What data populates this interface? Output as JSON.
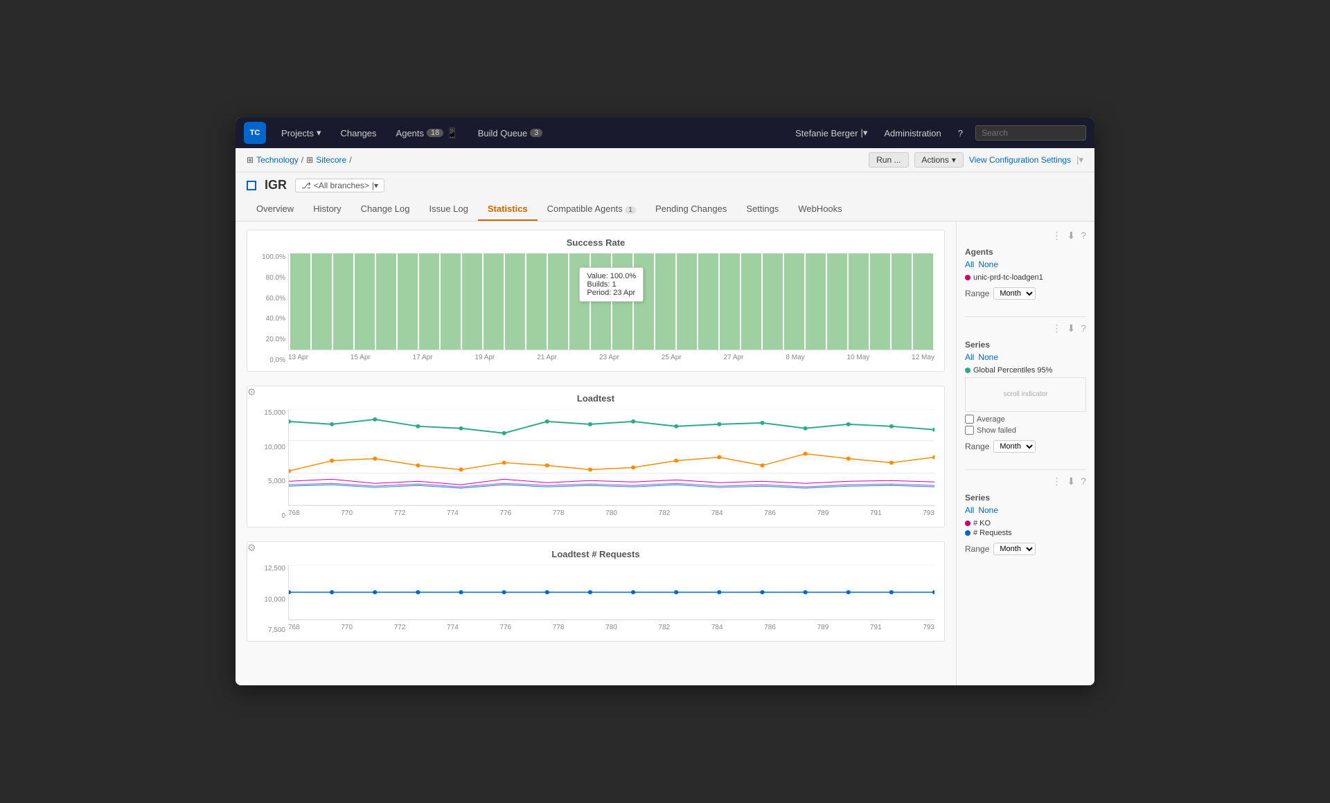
{
  "app": {
    "logo": "TC",
    "nav_items": [
      {
        "label": "Projects",
        "has_arrow": true
      },
      {
        "label": "Changes",
        "has_arrow": false
      },
      {
        "label": "Agents",
        "badge": "18",
        "has_icon": true
      },
      {
        "label": "Build Queue",
        "badge": "3"
      }
    ],
    "user": "Stefanie Berger",
    "admin": "Administration",
    "search_placeholder": "Search"
  },
  "breadcrumb": {
    "items": [
      "Technology",
      "Sitecore"
    ]
  },
  "toolbar": {
    "run_label": "Run ...",
    "actions_label": "Actions",
    "view_config_label": "View Configuration Settings"
  },
  "project": {
    "name": "IGR",
    "branch": "<All branches>"
  },
  "tabs": [
    {
      "label": "Overview",
      "active": false
    },
    {
      "label": "History",
      "active": false
    },
    {
      "label": "Change Log",
      "active": false
    },
    {
      "label": "Issue Log",
      "active": false
    },
    {
      "label": "Statistics",
      "active": true
    },
    {
      "label": "Compatible Agents",
      "badge": "1",
      "active": false
    },
    {
      "label": "Pending Changes",
      "active": false
    },
    {
      "label": "Settings",
      "active": false
    },
    {
      "label": "WebHooks",
      "active": false
    }
  ],
  "charts": {
    "success_rate": {
      "title": "Success Rate",
      "y_labels": [
        "100.0%",
        "80.0%",
        "60.0%",
        "40.0%",
        "20.0%",
        "0.0%"
      ],
      "x_labels": [
        "13 Apr",
        "15 Apr",
        "17 Apr",
        "19 Apr",
        "21 Apr",
        "23 Apr",
        "25 Apr",
        "27 Apr",
        "8 May",
        "10 May",
        "12 May"
      ],
      "tooltip": {
        "value": "Value: 100.0%",
        "builds": "Builds: 1",
        "period": "Period: 23 Apr"
      },
      "bar_count": 30,
      "agents": {
        "label": "Agents",
        "all": "All",
        "none": "None",
        "items": [
          {
            "name": "unic-prd-tc-loadgen1",
            "color": "#cc0066"
          }
        ]
      },
      "range_label": "Range",
      "range_value": "Month"
    },
    "loadtest": {
      "title": "Loadtest",
      "y_labels": [
        "15,000",
        "10,000",
        "5,000",
        "0"
      ],
      "x_labels": [
        "768",
        "770",
        "772",
        "774",
        "776",
        "778",
        "780",
        "782",
        "784",
        "786",
        "789",
        "791",
        "793"
      ],
      "series": {
        "label": "Series",
        "all": "All",
        "none": "None",
        "items": [
          {
            "name": "Global Percentiles 95%",
            "color": "#2daa88"
          }
        ]
      },
      "average_label": "Average",
      "show_failed_label": "Show failed",
      "range_label": "Range",
      "range_value": "Month"
    },
    "loadtest_requests": {
      "title": "Loadtest # Requests",
      "y_labels": [
        "12,500",
        "10,000",
        "7,500"
      ],
      "x_labels": [
        "768",
        "770",
        "772",
        "774",
        "776",
        "778",
        "780",
        "782",
        "784",
        "786",
        "789",
        "791",
        "793"
      ],
      "series": {
        "label": "Series",
        "all": "All",
        "none": "None",
        "items": [
          {
            "name": "# KO",
            "color": "#cc0066"
          },
          {
            "name": "# Requests",
            "color": "#0066cc"
          }
        ]
      },
      "range_label": "Range",
      "range_value": "Month"
    }
  }
}
